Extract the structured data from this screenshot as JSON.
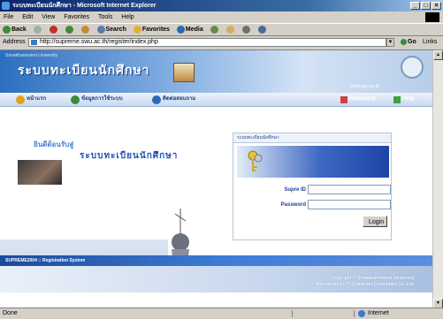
{
  "window": {
    "title": "ระบบทะเบียนนักศึกษา - Microsoft Internet Explorer",
    "buttons": [
      "_",
      "□",
      "×"
    ]
  },
  "menubar": {
    "items": [
      "File",
      "Edit",
      "View",
      "Favorites",
      "Tools",
      "Help"
    ]
  },
  "toolbar": {
    "items": [
      {
        "label": "Back",
        "icon": "back-arrow-icon"
      },
      {
        "label": "",
        "icon": "forward-arrow-icon"
      },
      {
        "label": "",
        "icon": "stop-icon"
      },
      {
        "label": "",
        "icon": "refresh-icon"
      },
      {
        "label": "",
        "icon": "home-icon"
      },
      {
        "label": "Search",
        "icon": "search-icon"
      },
      {
        "label": "Favorites",
        "icon": "favorites-icon"
      },
      {
        "label": "Media",
        "icon": "media-icon"
      },
      {
        "label": "",
        "icon": "history-icon"
      },
      {
        "label": "",
        "icon": "mail-icon"
      },
      {
        "label": "",
        "icon": "print-icon"
      },
      {
        "label": "",
        "icon": "edit-icon"
      }
    ]
  },
  "address": {
    "label": "Address",
    "url": "http://supreme.swu.ac.th/register/index.php",
    "go": "Go",
    "links": "Links"
  },
  "banner": {
    "small": "Srinakharinwirot University",
    "title": "ระบบทะเบียนนักศึกษา",
    "right": "www.swu.ac.th"
  },
  "nav": {
    "items": [
      "หน้าแรก",
      "ข้อมูลการใช้ระบบ",
      "ติดต่อสอบถาม"
    ],
    "right": [
      "Webboard",
      "Help"
    ]
  },
  "hero": {
    "welcome": "ยินดีต้อนรับสู่",
    "system": "ระบบทะเบียนนักศึกษา"
  },
  "login": {
    "header": "ระบบทะเบียนนักศึกษา",
    "user_label": "Supre ID",
    "password_label": "Password",
    "user_value": "",
    "password_value": "",
    "button": "Login"
  },
  "footer": {
    "bar": "SUPREME2004 :: Registration System",
    "copy1": "Copyright © Srinakharinwirot University",
    "copy2": "Maintained by IT-Computer Consultant Co.,Ltd."
  },
  "status": {
    "left": "Done",
    "zone": "Internet"
  }
}
